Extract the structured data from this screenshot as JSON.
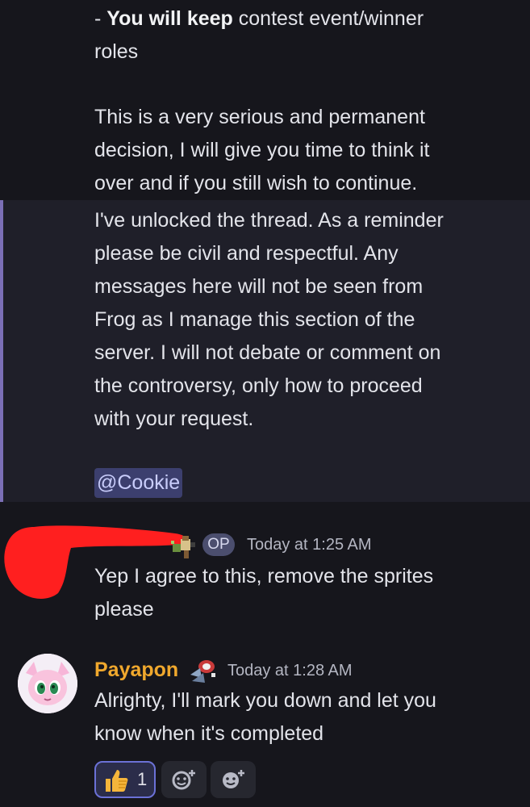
{
  "message_prev": {
    "line1_prefix": "- ",
    "line1_bold": "You will keep",
    "line1_rest": " contest event/winner",
    "line2": "roles",
    "para2": [
      "This is a very serious and permanent",
      "decision, I will give you time to think it",
      "over and if you still wish to continue."
    ]
  },
  "mod_message": {
    "lines": [
      "I've unlocked the thread. As a reminder",
      "please be civil and respectful. Any",
      "messages here will not be seen from",
      "Frog as I manage this section of the",
      "server. I will not debate or comment on",
      "the controversy, only how to proceed",
      "with your request."
    ],
    "mention": "@Cookie"
  },
  "op_message": {
    "badge": "OP",
    "timestamp": "Today at 1:25 AM",
    "lines": [
      "Yep I agree to this, remove the sprites",
      "please"
    ]
  },
  "reply_message": {
    "author": "Payapon",
    "timestamp": "Today at 1:28 AM",
    "lines": [
      "Alrighty, I'll mark you down and let you",
      "know when it's completed"
    ]
  },
  "reactions": {
    "thumbs_count": "1",
    "items": [
      "thumbs-up-icon",
      "add-reaction-icon",
      "add-super-reaction-icon"
    ]
  },
  "colors": {
    "background": "#16161c",
    "mention_highlight": "#1f1f29",
    "mention_bar": "#7b6fb6",
    "username": "#f0a82d",
    "redaction": "#ff1f1f"
  }
}
